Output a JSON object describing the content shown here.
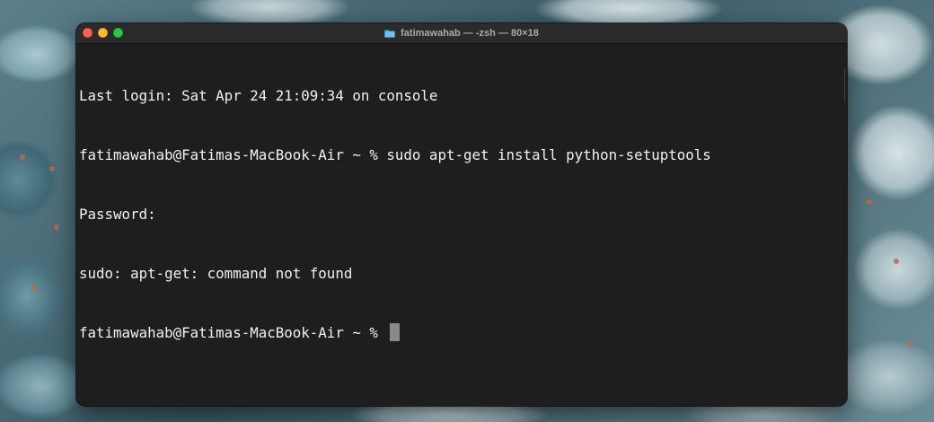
{
  "window": {
    "title": "fatimawahab — -zsh — 80×18",
    "title_icon": "folder-icon",
    "accent_colors": {
      "close": "#fe5f57",
      "minimize": "#febc2e",
      "zoom": "#28c840",
      "background": "#1e1e1e",
      "text": "#f2f2f2"
    }
  },
  "terminal": {
    "lines": [
      "Last login: Sat Apr 24 21:09:34 on console",
      "fatimawahab@Fatimas-MacBook-Air ~ % sudo apt-get install python-setuptools",
      "Password:",
      "sudo: apt-get: command not found"
    ],
    "prompt": "fatimawahab@Fatimas-MacBook-Air ~ % "
  }
}
